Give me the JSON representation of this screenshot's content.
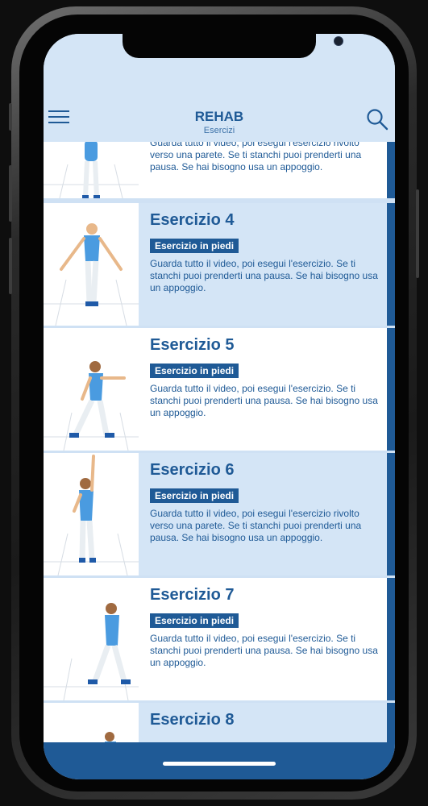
{
  "header": {
    "title": "REHAB",
    "subtitle": "Esercizi"
  },
  "icons": {
    "menu": "hamburger-menu-icon",
    "search": "search-icon"
  },
  "colors": {
    "accent": "#1f5a96",
    "row_light": "#d4e5f6",
    "row_white": "#ffffff"
  },
  "exercises": [
    {
      "title": "",
      "badge": "",
      "description": "Guarda tutto il video, poi esegui l'esercizio rivolto verso una parete. Se ti stanchi puoi prenderti una pausa. Se hai bisogno usa un appoggio."
    },
    {
      "title": "Esercizio 4",
      "badge": "Esercizio in piedi",
      "description": "Guarda tutto il video, poi esegui l'esercizio. Se ti stanchi puoi prenderti una pausa. Se hai bisogno usa un appoggio."
    },
    {
      "title": "Esercizio 5",
      "badge": "Esercizio in piedi",
      "description": "Guarda tutto il video, poi esegui l'esercizio. Se ti stanchi puoi prenderti una pausa. Se hai bisogno usa un appoggio."
    },
    {
      "title": "Esercizio 6",
      "badge": "Esercizio in piedi",
      "description": "Guarda tutto il video, poi esegui l'esercizio rivolto verso una parete. Se ti stanchi puoi prenderti una pausa.  Se hai bisogno usa un appoggio."
    },
    {
      "title": "Esercizio 7",
      "badge": "Esercizio in piedi",
      "description": "Guarda tutto il video, poi esegui l'esercizio. Se ti stanchi puoi prenderti una pausa. Se hai bisogno usa un appoggio."
    },
    {
      "title": "Esercizio 8",
      "badge": "",
      "description": ""
    }
  ]
}
